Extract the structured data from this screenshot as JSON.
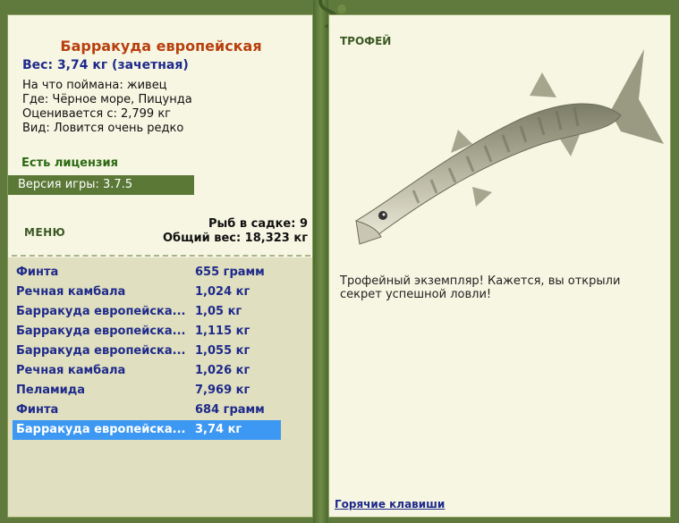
{
  "fish": {
    "title": "Барракуда европейская",
    "weight_line": "Вес: 3,74 кг (зачетная)",
    "bait": "На что поймана: живец",
    "location": "Где: Чёрное море, Пицунда",
    "valued_from": "Оценивается с: 2,799 кг",
    "kind": "Вид: Ловится очень редко"
  },
  "license": "Есть лицензия",
  "version": "Версия игры: 3.7.5",
  "menu_label": "МЕНЮ",
  "stats": {
    "count_line": "Рыб в садке: 9",
    "total_line": "Общий вес: 18,323 кг"
  },
  "catch_list": [
    {
      "name": "Финта",
      "weight": "655 грамм"
    },
    {
      "name": "Речная камбала",
      "weight": "1,024 кг"
    },
    {
      "name": "Барракуда европейска...",
      "weight": "1,05 кг"
    },
    {
      "name": "Барракуда европейска...",
      "weight": "1,115 кг"
    },
    {
      "name": "Барракуда европейска...",
      "weight": "1,055 кг"
    },
    {
      "name": "Речная камбала",
      "weight": "1,026 кг"
    },
    {
      "name": "Пеламида",
      "weight": "7,969 кг"
    },
    {
      "name": "Финта",
      "weight": "684 грамм"
    },
    {
      "name": "Барракуда европейска...",
      "weight": "3,74 кг"
    }
  ],
  "selected_index": 8,
  "trophy": {
    "label": "ТРОФЕЙ",
    "text": "Трофейный экземпляр! Кажется, вы открыли секрет успешной ловли!"
  },
  "hotkeys": "Горячие клавиши",
  "colors": {
    "selected_row": "#3c98f2",
    "panel_bg": "#f7f6e3",
    "frame": "#5f7a3c"
  }
}
